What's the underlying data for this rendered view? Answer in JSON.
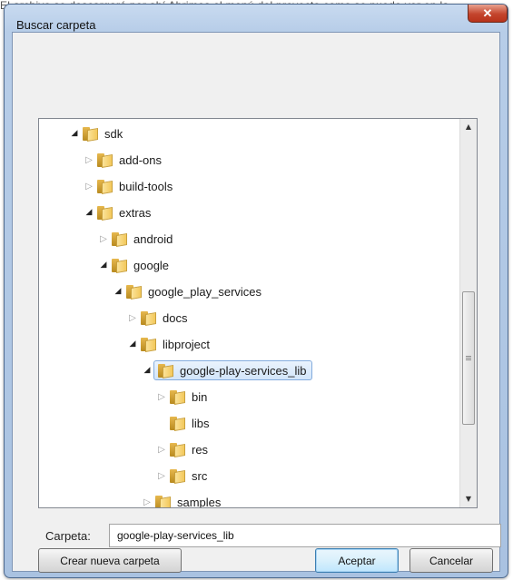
{
  "background": {
    "text": "El archivo se descargará por ahí Abrimos el menú del proyecto como se puede ver en la"
  },
  "dialog": {
    "title": "Buscar carpeta",
    "close_glyph": "✕",
    "tree": {
      "nodes": [
        {
          "label": "sdk",
          "state": "expanded"
        },
        {
          "label": "add-ons",
          "state": "collapsed"
        },
        {
          "label": "build-tools",
          "state": "collapsed"
        },
        {
          "label": "extras",
          "state": "expanded"
        },
        {
          "label": "android",
          "state": "collapsed"
        },
        {
          "label": "google",
          "state": "expanded"
        },
        {
          "label": "google_play_services",
          "state": "expanded"
        },
        {
          "label": "docs",
          "state": "collapsed"
        },
        {
          "label": "libproject",
          "state": "expanded"
        },
        {
          "label": "google-play-services_lib",
          "state": "expanded",
          "selected": true
        },
        {
          "label": "bin",
          "state": "collapsed"
        },
        {
          "label": "libs",
          "state": "leaf"
        },
        {
          "label": "res",
          "state": "collapsed"
        },
        {
          "label": "src",
          "state": "collapsed"
        },
        {
          "label": "samples",
          "state": "collapsed"
        }
      ]
    },
    "folder_field": {
      "label": "Carpeta:",
      "value": "google-play-services_lib"
    },
    "buttons": {
      "new_folder": "Crear nueva carpeta",
      "accept": "Aceptar",
      "cancel": "Cancelar"
    },
    "colors": {
      "frame": "#a9c2e1",
      "close": "#c4452d",
      "selection": "#d2e5fa"
    }
  }
}
